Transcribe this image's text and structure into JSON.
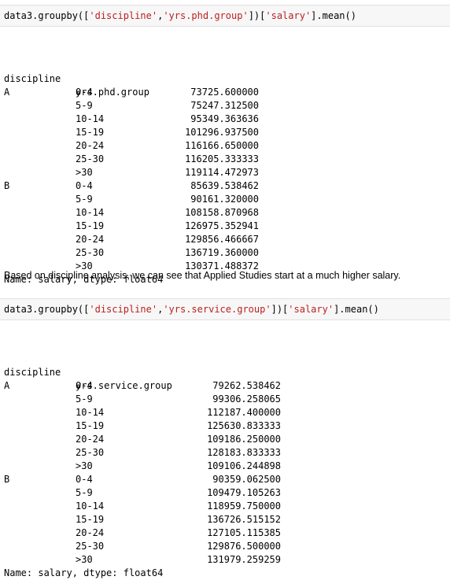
{
  "cell1": {
    "code_pre": "data3.groupby([",
    "str_a": "'discipline'",
    "comma": ",",
    "str_b": "'yrs.phd.group'",
    "mid": "])[",
    "str_c": "'salary'",
    "code_post": "].mean()"
  },
  "out1": {
    "header_col1": "discipline",
    "header_col2": "yrs.phd.group",
    "rows": [
      {
        "d": "A",
        "g": "0-4",
        "v": "73725.600000"
      },
      {
        "d": "",
        "g": "5-9",
        "v": "75247.312500"
      },
      {
        "d": "",
        "g": "10-14",
        "v": "95349.363636"
      },
      {
        "d": "",
        "g": "15-19",
        "v": "101296.937500"
      },
      {
        "d": "",
        "g": "20-24",
        "v": "116166.650000"
      },
      {
        "d": "",
        "g": "25-30",
        "v": "116205.333333"
      },
      {
        "d": "",
        "g": ">30",
        "v": "119114.472973"
      },
      {
        "d": "B",
        "g": "0-4",
        "v": "85639.538462"
      },
      {
        "d": "",
        "g": "5-9",
        "v": "90161.320000"
      },
      {
        "d": "",
        "g": "10-14",
        "v": "108158.870968"
      },
      {
        "d": "",
        "g": "15-19",
        "v": "126975.352941"
      },
      {
        "d": "",
        "g": "20-24",
        "v": "129856.466667"
      },
      {
        "d": "",
        "g": "25-30",
        "v": "136719.360000"
      },
      {
        "d": "",
        "g": ">30",
        "v": "130371.488372"
      }
    ],
    "footer": "Name: salary, dtype: float64"
  },
  "prose": "Based on discipline analysis, we can see that Applied Studies start at a much higher salary.",
  "cell2": {
    "code_pre": "data3.groupby([",
    "str_a": "'discipline'",
    "comma": ",",
    "str_b": "'yrs.service.group'",
    "mid": "])[",
    "str_c": "'salary'",
    "code_post": "].mean()"
  },
  "out2": {
    "header_col1": "discipline",
    "header_col2": "yrs.service.group",
    "rows": [
      {
        "d": "A",
        "g": "0-4",
        "v": "79262.538462"
      },
      {
        "d": "",
        "g": "5-9",
        "v": "99306.258065"
      },
      {
        "d": "",
        "g": "10-14",
        "v": "112187.400000"
      },
      {
        "d": "",
        "g": "15-19",
        "v": "125630.833333"
      },
      {
        "d": "",
        "g": "20-24",
        "v": "109186.250000"
      },
      {
        "d": "",
        "g": "25-30",
        "v": "128183.833333"
      },
      {
        "d": "",
        "g": ">30",
        "v": "109106.244898"
      },
      {
        "d": "B",
        "g": "0-4",
        "v": "90359.062500"
      },
      {
        "d": "",
        "g": "5-9",
        "v": "109479.105263"
      },
      {
        "d": "",
        "g": "10-14",
        "v": "118959.750000"
      },
      {
        "d": "",
        "g": "15-19",
        "v": "136726.515152"
      },
      {
        "d": "",
        "g": "20-24",
        "v": "127105.115385"
      },
      {
        "d": "",
        "g": "25-30",
        "v": "129876.500000"
      },
      {
        "d": "",
        "g": ">30",
        "v": "131979.259259"
      }
    ],
    "footer": "Name: salary, dtype: float64"
  }
}
